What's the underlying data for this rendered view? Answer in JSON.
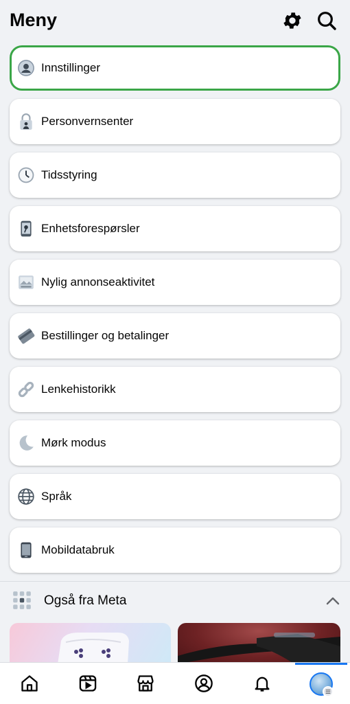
{
  "header": {
    "title": "Meny",
    "settings_icon": "gear-icon",
    "search_icon": "search-icon"
  },
  "menu": [
    {
      "label": "Innstillinger",
      "icon": "user-circle-icon",
      "highlighted": true
    },
    {
      "label": "Personvernsenter",
      "icon": "lock-person-icon"
    },
    {
      "label": "Tidsstyring",
      "icon": "clock-icon"
    },
    {
      "label": "Enhetsforespørsler",
      "icon": "phone-device-icon"
    },
    {
      "label": "Nylig annonseaktivitet",
      "icon": "ad-activity-icon"
    },
    {
      "label": "Bestillinger og betalinger",
      "icon": "card-icon"
    },
    {
      "label": "Lenkehistorikk",
      "icon": "link-icon"
    },
    {
      "label": "Mørk modus",
      "icon": "moon-icon"
    },
    {
      "label": "Språk",
      "icon": "globe-icon"
    },
    {
      "label": "Mobildatabruk",
      "icon": "mobile-icon"
    }
  ],
  "meta_section": {
    "label": "Også fra Meta",
    "icon": "apps-grid-icon",
    "expanded": true
  },
  "bottom_nav": [
    "home-icon",
    "video-icon",
    "marketplace-icon",
    "profile-icon",
    "notifications-icon",
    "menu-avatar"
  ],
  "colors": {
    "highlight_border": "#3aa647",
    "accent": "#1877f2",
    "background": "#f0f2f5"
  }
}
